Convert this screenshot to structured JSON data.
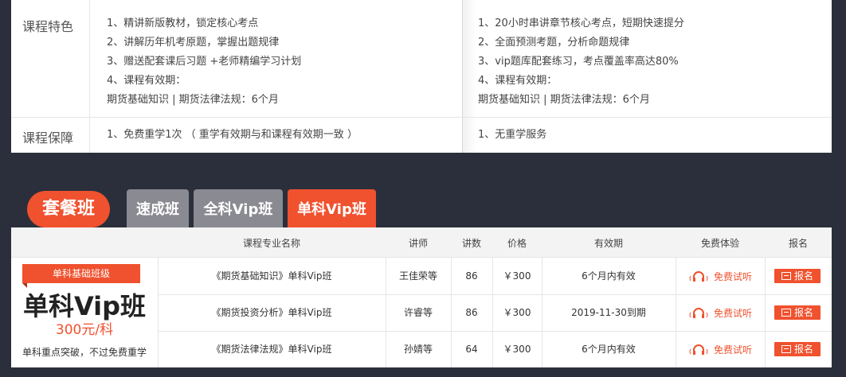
{
  "features": {
    "row1_label": "课程特色",
    "row2_label": "课程保障",
    "left": [
      "1、精讲新版教材，锁定核心考点",
      "2、讲解历年机考原题，掌握出题规律",
      "3、赠送配套课后习题 +老师精编学习计划",
      "4、课程有效期：",
      "期货基础知识 | 期货法律法规：6个月"
    ],
    "right": [
      "1、20小时串讲章节核心考点，短期快速提分",
      "2、全面预测考题，分析命题规律",
      "3、vip题库配套练习，考点覆盖率高达80%",
      "4、课程有效期：",
      "期货基础知识 | 期货法律法规：6个月"
    ],
    "guarantee_left": "1、免费重学1次 （ 重学有效期与和课程有效期一致 ）",
    "guarantee_right": "1、无重学服务"
  },
  "tabs": {
    "main": "套餐班",
    "items": [
      "速成班",
      "全科Vip班",
      "单科Vip班"
    ]
  },
  "table": {
    "headers": [
      "课程专业名称",
      "讲师",
      "讲数",
      "价格",
      "有效期",
      "免费体验",
      "报名"
    ],
    "promo": {
      "badge": "单科基础班级",
      "title": "单科Vip班",
      "price": "300元/科",
      "note": "单科重点突破，不过免费重学"
    },
    "rows": [
      {
        "name": "《期货基础知识》单科Vip班",
        "teacher": "王佳荣等",
        "lessons": "86",
        "price": "￥300",
        "validity": "6个月内有效",
        "trial": "免费试听",
        "signup": "报名"
      },
      {
        "name": "《期货投资分析》单科Vip班",
        "teacher": "许睿等",
        "lessons": "86",
        "price": "￥300",
        "validity": "2019-11-30到期",
        "trial": "免费试听",
        "signup": "报名"
      },
      {
        "name": "《期货法律法规》单科Vip班",
        "teacher": "孙婧等",
        "lessons": "64",
        "price": "￥300",
        "validity": "6个月内有效",
        "trial": "免费试听",
        "signup": "报名"
      }
    ]
  },
  "colors": {
    "accent": "#f0512e",
    "tab_gray": "#8a8a92",
    "background": "#2a2f3b"
  }
}
